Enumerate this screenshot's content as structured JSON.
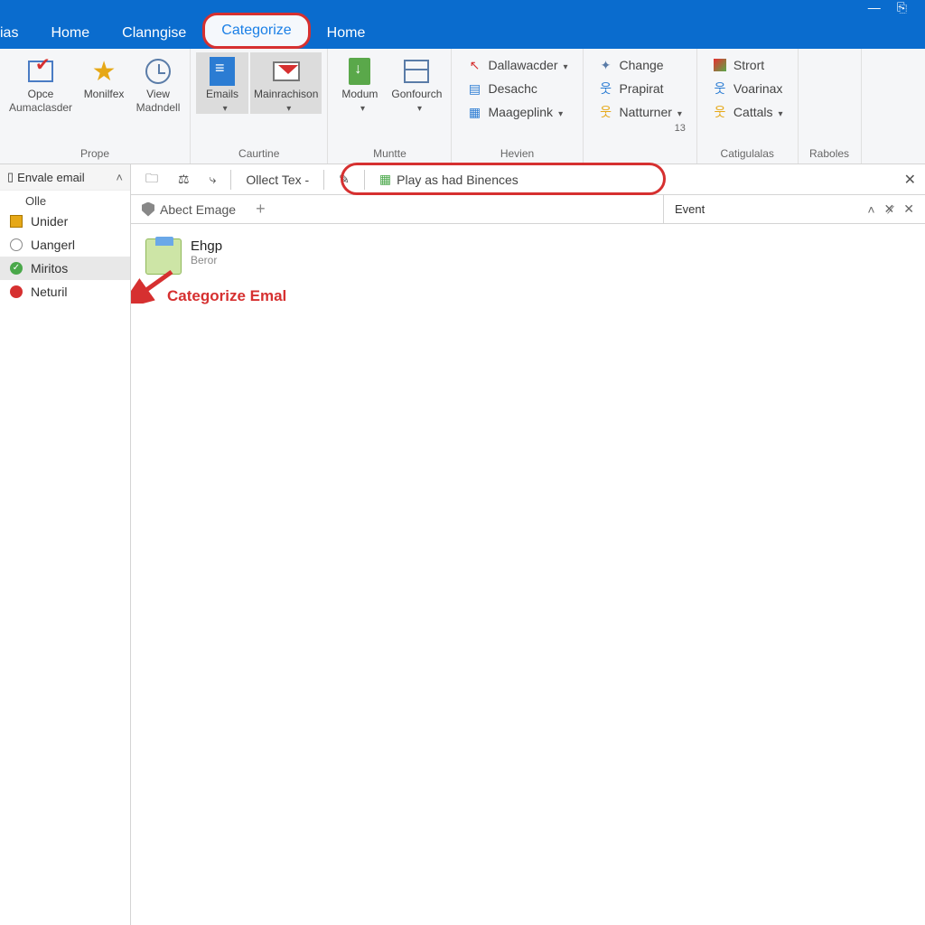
{
  "titlebar": {
    "minimize": "—"
  },
  "tabs": {
    "items": [
      "ias",
      "Home",
      "Clanngise",
      "Categorize",
      "Home"
    ],
    "highlighted_index": 3
  },
  "ribbon": {
    "g1": {
      "btn1": {
        "l1": "Opce",
        "l2": "Aumaclasder"
      },
      "btn2": {
        "l1": "Monilfex",
        "l2": ""
      },
      "btn3": {
        "l1": "View",
        "l2": "Madndell"
      },
      "label": "Prope"
    },
    "g2": {
      "btn1": {
        "l1": "Emails"
      },
      "btn2": {
        "l1": "Mainrachison"
      },
      "label": "Caurtine"
    },
    "g3": {
      "btn1": {
        "l1": "Modum"
      },
      "btn2": {
        "l1": "Gonfourch"
      },
      "label": "Muntte"
    },
    "g4": {
      "r1": "Dallawacder",
      "r2": "Desachc",
      "r3": "Maageplink",
      "label": "Hevien"
    },
    "g5": {
      "r1": "Change",
      "r2": "Prapirat",
      "r3": "Natturner",
      "label": "13"
    },
    "g6": {
      "r1": "Strort",
      "r2": "Voarinax",
      "r3": "Cattals",
      "label": "Catigulalas"
    },
    "g7": {
      "label": "Raboles"
    }
  },
  "subbar": {
    "b1": "Ollect Tex -",
    "b2": "Play as had Binences",
    "close": "✕"
  },
  "doctabs": {
    "t1": "Abect Emage",
    "add": "+",
    "right": "Event"
  },
  "sidebar": {
    "head": "Envale email",
    "sub": "Olle",
    "items": [
      {
        "label": "Unider"
      },
      {
        "label": "Uangerl"
      },
      {
        "label": "Miritos"
      },
      {
        "label": "Neturil"
      }
    ]
  },
  "content": {
    "mail": {
      "title": "Ehgp",
      "sub": "Beror"
    },
    "annotation": "Categorize Emal"
  }
}
